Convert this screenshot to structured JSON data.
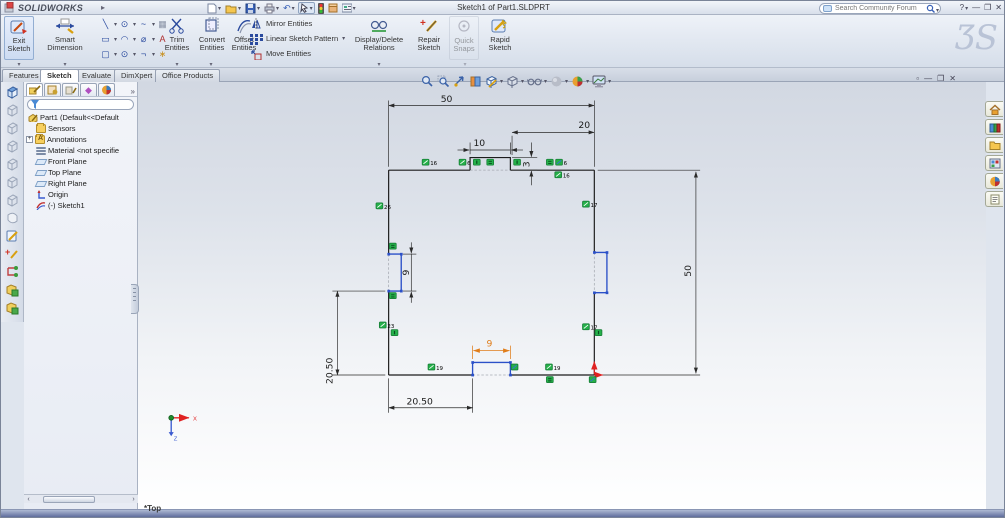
{
  "titlebar": {
    "brand": "SOLIDWORKS",
    "title": "Sketch1 of Part1.SLDPRT",
    "search_placeholder": "Search Community Forum",
    "quick_access": [
      "new",
      "open",
      "save",
      "print",
      "undo",
      "select",
      "xpress-products",
      "add-ins",
      "options"
    ],
    "window_controls": [
      "help",
      "minimize",
      "restore",
      "close"
    ]
  },
  "ribbon": {
    "exit_sketch": [
      "Exit",
      "Sketch"
    ],
    "smart_dimension": [
      "Smart",
      "Dimension"
    ],
    "trim": [
      "Trim",
      "Entities"
    ],
    "convert": [
      "Convert",
      "Entities"
    ],
    "offset": [
      "Offset",
      "Entities"
    ],
    "mirror": "Mirror Entities",
    "pattern": "Linear Sketch Pattern",
    "move": "Move Entities",
    "display_delete": [
      "Display/Delete",
      "Relations"
    ],
    "repair": [
      "Repair",
      "Sketch"
    ],
    "quick_snaps": [
      "Quick",
      "Snaps"
    ],
    "rapid": [
      "Rapid",
      "Sketch"
    ]
  },
  "tabs": [
    "Features",
    "Sketch",
    "Evaluate",
    "DimXpert",
    "Office Products"
  ],
  "active_tab": "Sketch",
  "tree": {
    "root": "Part1 (Default<<Default",
    "items": [
      "Sensors",
      "Annotations",
      "Material <not specifie",
      "Front Plane",
      "Top Plane",
      "Right Plane",
      "Origin",
      "(-) Sketch1"
    ]
  },
  "headsup_tools": [
    "zoom-to-fit",
    "zoom-to-area",
    "previous-view",
    "section-view",
    "view-orientation",
    "display-style",
    "hide-show-items",
    "edit-appearance",
    "apply-scene",
    "view-settings"
  ],
  "taskpane_tabs": [
    "solidworks-resources",
    "design-library",
    "file-explorer",
    "palette",
    "appearances",
    "custom-properties"
  ],
  "viewport": {
    "view_label": "*Top",
    "triad_x": "X",
    "triad_z": "Z"
  },
  "sketch": {
    "dims": {
      "width_top": "50",
      "right_offset_top": "20",
      "bump_width": "10",
      "bump_height": "3",
      "left_notch_height": "9",
      "height_right": "50",
      "left_bottom_offset": "20.50",
      "bottom_left_offset": "20.50",
      "bottom_notch_width": "9"
    },
    "badges": [
      "16",
      "6",
      "",
      "",
      "",
      "",
      "6",
      "16",
      "17",
      "17",
      "",
      "26",
      "",
      "",
      "23",
      "",
      "19",
      "19",
      "",
      "",
      ""
    ]
  },
  "colors": {
    "sketch_line": "#1c1c1c",
    "selected_blue": "#2b50c8",
    "construction_gray": "#a6aab2",
    "relation_green": "#25b14a",
    "selected_dim_orange": "#e07d1a",
    "origin_red": "#e02222"
  }
}
